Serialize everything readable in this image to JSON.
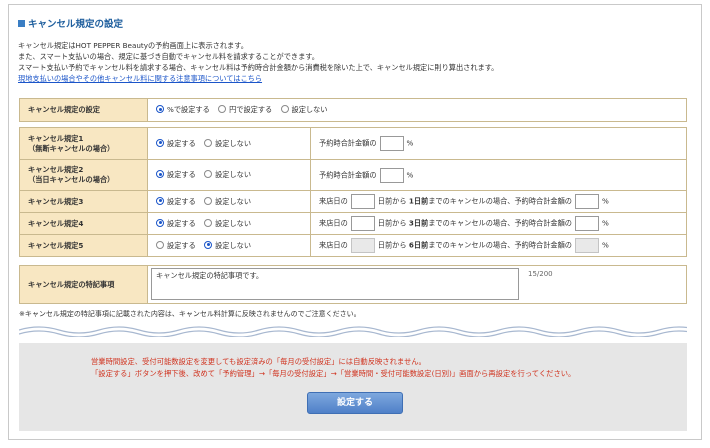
{
  "section_title": "キャンセル規定の設定",
  "description": [
    "キャンセル規定はHOT PEPPER Beautyの予約画面上に表示されます。",
    "また、スマート支払いの場合、規定に基づき自動でキャンセル料を請求することができます。",
    "スマート支払い予約でキャンセル料を請求する場合、キャンセル料は予約時合計金額から消費税を除いた上で、キャンセル規定に則り算出されます。"
  ],
  "description_link": "現地支払いの場合やその他キャンセル料に関する注意事項についてはこちら",
  "setting_row": {
    "label": "キャンセル規定の設定",
    "options": [
      "%で設定する",
      "円で設定する",
      "設定しない"
    ],
    "selected": 0
  },
  "rules": [
    {
      "label_line1": "キャンセル規定1",
      "label_line2": "（無断キャンセルの場合）",
      "opt_on": "設定する",
      "opt_off": "設定しない",
      "selected": "on",
      "type": "simple",
      "prefix": "予約時合計金額の",
      "suffix": "%"
    },
    {
      "label_line1": "キャンセル規定2",
      "label_line2": "（当日キャンセルの場合）",
      "opt_on": "設定する",
      "opt_off": "設定しない",
      "selected": "on",
      "type": "simple",
      "prefix": "予約時合計金額の",
      "suffix": "%"
    },
    {
      "label_line1": "キャンセル規定3",
      "label_line2": "",
      "opt_on": "設定する",
      "opt_off": "設定しない",
      "selected": "on",
      "type": "days",
      "p1": "来店日の",
      "p2": "日前から",
      "days_bold": "1日前",
      "p3": "までのキャンセルの場合、予約時合計金額の",
      "suffix": "%"
    },
    {
      "label_line1": "キャンセル規定4",
      "label_line2": "",
      "opt_on": "設定する",
      "opt_off": "設定しない",
      "selected": "on",
      "type": "days",
      "p1": "来店日の",
      "p2": "日前から",
      "days_bold": "3日前",
      "p3": "までのキャンセルの場合、予約時合計金額の",
      "suffix": "%"
    },
    {
      "label_line1": "キャンセル規定5",
      "label_line2": "",
      "opt_on": "設定する",
      "opt_off": "設定しない",
      "selected": "off",
      "type": "days",
      "p1": "来店日の",
      "p2": "日前から",
      "days_bold": "6日前",
      "p3": "までのキャンセルの場合、予約時合計金額の",
      "suffix": "%"
    }
  ],
  "special_note": {
    "label": "キャンセル規定の特記事項",
    "value": "キャンセル規定の特記事項です。",
    "counter": "15/200"
  },
  "footnote": "※キャンセル規定の特記事項に記載された内容は、キャンセル料計算に反映されませんのでご注意ください。",
  "warnings": [
    "営業時間設定、受付可能数設定を変更しても設定済みの「毎月の受付設定」には自動反映されません。",
    "「設定する」ボタンを押下後、改めて「予約管理」→「毎月の受付設定」→「営業時間・受付可能数設定(日別)」画面から再設定を行ってください。"
  ],
  "submit_label": "設定する",
  "colors": {
    "label_bg": "#f8e7c2",
    "title": "#1f5f9e",
    "link": "#1b55c9",
    "warning": "#d0321e",
    "button": "#5b8bd0"
  }
}
